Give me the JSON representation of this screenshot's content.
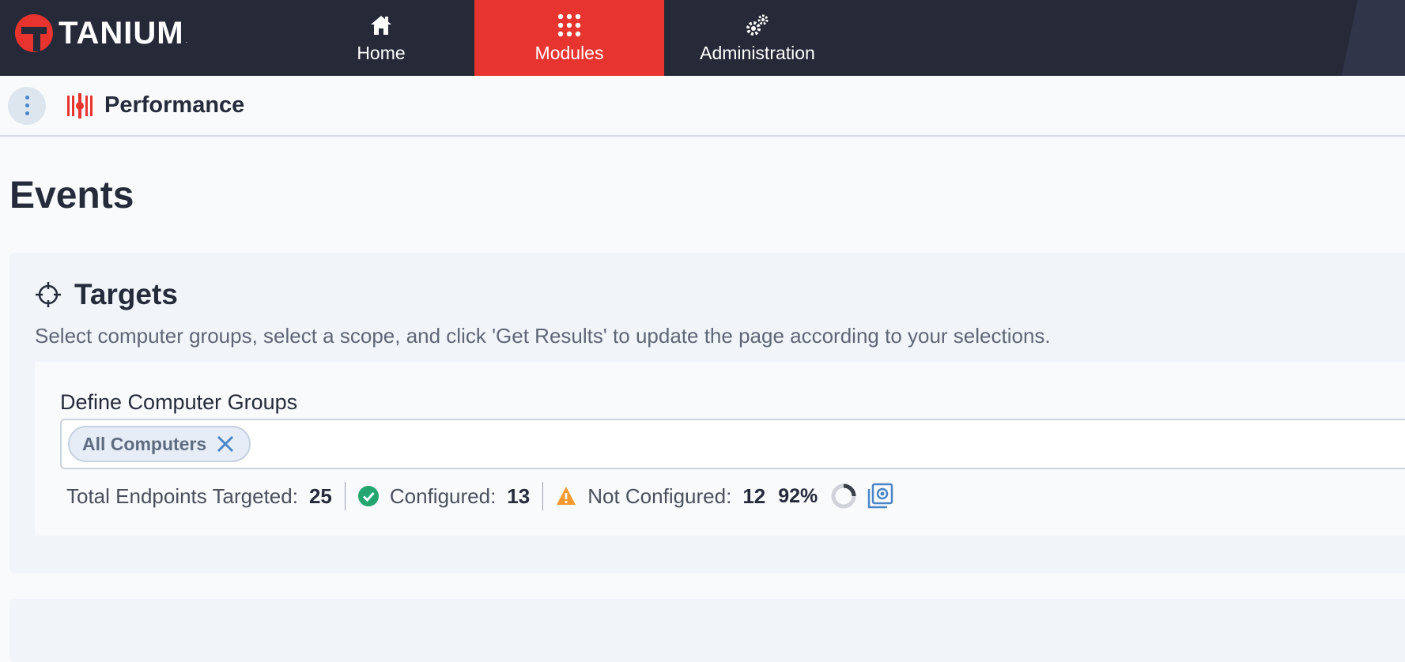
{
  "app": {
    "logo_text": "TANIUM",
    "logo_tm": ".",
    "brand_red": "#e8342e",
    "nav_bg": "#262a38"
  },
  "nav": {
    "tabs": [
      {
        "label": "Home",
        "icon": "home-icon"
      },
      {
        "label": "Modules",
        "icon": "grid-icon",
        "active": true
      },
      {
        "label": "Administration",
        "icon": "gears-icon"
      }
    ]
  },
  "module": {
    "name": "Performance",
    "icon": "performance-icon"
  },
  "page": {
    "title": "Events"
  },
  "targets": {
    "title": "Targets",
    "description": "Select computer groups, select a scope, and click 'Get Results' to update the page according to your selections.",
    "field_label": "Define Computer Groups",
    "selected_group": "All Computers",
    "stats": {
      "total_label": "Total Endpoints Targeted:",
      "total_value": "25",
      "configured_label": "Configured:",
      "configured_value": "13",
      "not_configured_label": "Not Configured:",
      "not_configured_value": "12",
      "percent": "92%"
    }
  }
}
